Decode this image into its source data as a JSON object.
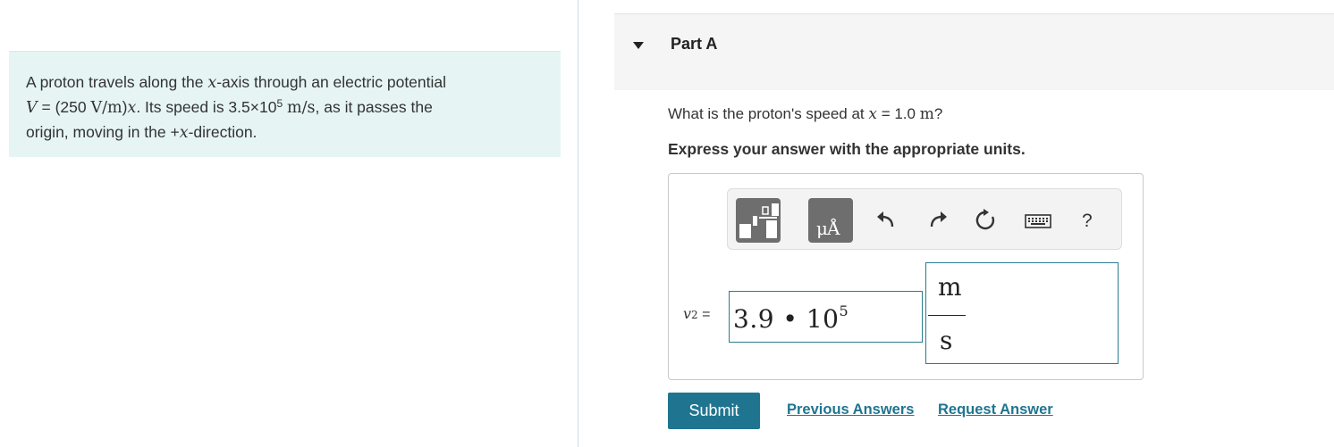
{
  "problem": {
    "t1": "A proton travels along the ",
    "x1": "x",
    "t2": "-axis through an electric potential",
    "V": "V",
    "eq": " = (250 ",
    "unit_Vm": "V/m",
    "close": ")",
    "x2": "x",
    "t3": ". Its speed is 3.5×10",
    "exp": "5",
    "sp": " ",
    "unit_ms": "m/s",
    "t4": ", as it passes the",
    "t5": "origin, moving in the +",
    "x3": "x",
    "t6": "-direction."
  },
  "part": {
    "title": "Part A",
    "q1": "What is the proton's speed at ",
    "qx": "x",
    "q2": " = 1.0 ",
    "qunit": "m",
    "q3": "?",
    "instruction": "Express your answer with the appropriate units."
  },
  "toolbar": {
    "units_glyph": "μÅ",
    "help": "?"
  },
  "answer": {
    "var": "v",
    "sub": "2",
    "eq": " =",
    "mantissa": "3.9 • 10",
    "exponent": "5",
    "unit_num": "m",
    "unit_den": "s"
  },
  "actions": {
    "submit": "Submit",
    "previous": "Previous Answers",
    "request": "Request Answer"
  },
  "colors": {
    "accent": "#1f7590",
    "problem_bg": "#e6f4f4",
    "input_border": "#2a7d8c"
  },
  "icons": [
    "templates-icon",
    "units-icon",
    "undo-icon",
    "redo-icon",
    "reset-icon",
    "keyboard-icon",
    "help-icon",
    "caret-down-icon"
  ]
}
